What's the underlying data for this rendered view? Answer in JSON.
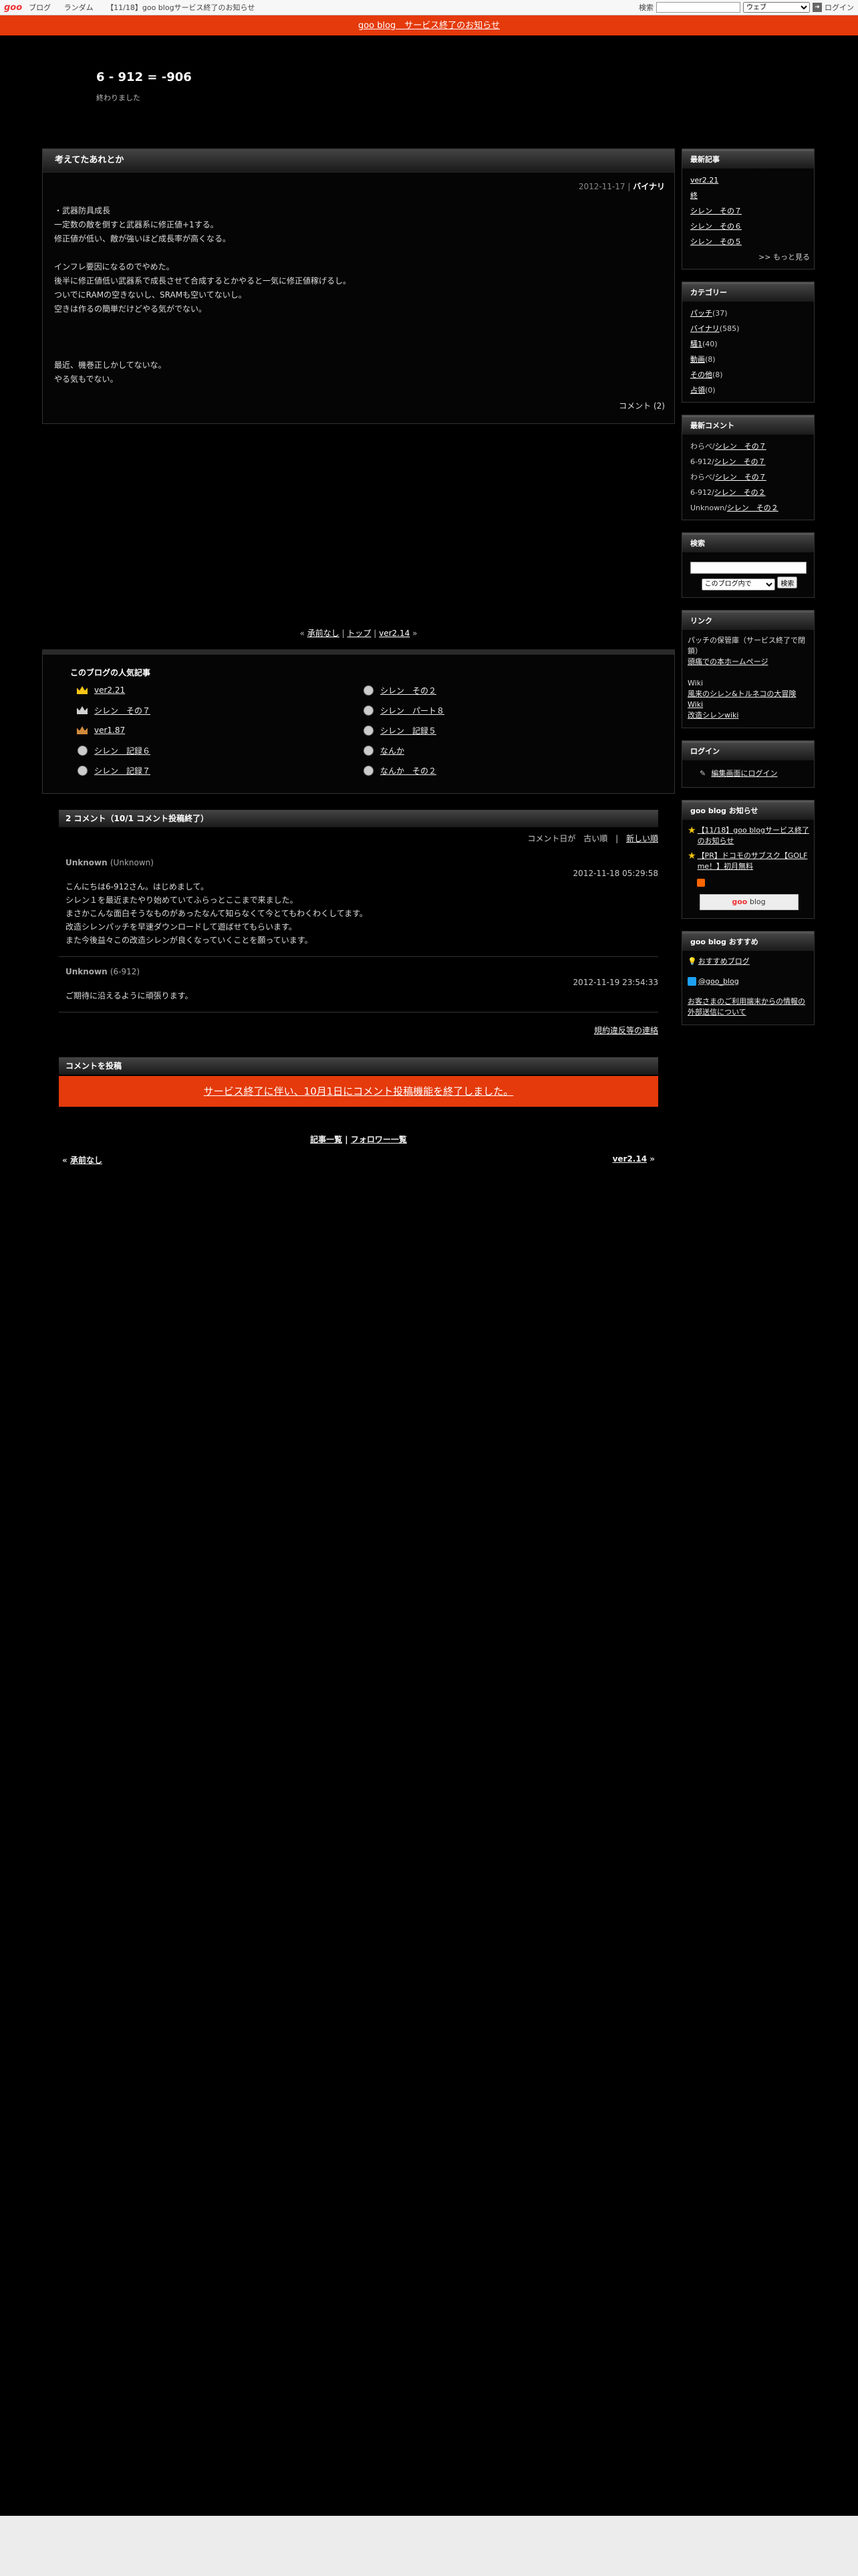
{
  "topbar": {
    "logo": "goo",
    "nav": [
      "ブログ",
      "ランダム",
      "【11/18】goo blogサービス終了のお知らせ"
    ],
    "search_label": "検索",
    "search_select": "ウェブ",
    "login": "ログイン"
  },
  "notice": "goo blog　サービス終了のお知らせ",
  "blog": {
    "title": "6 - 912 = -906",
    "description": "終わりました"
  },
  "entry": {
    "title": "考えてたあれとか",
    "date": "2012-11-17",
    "category": "バイナリ",
    "lines": [
      "・武器防具成長",
      "一定数の敵を倒すと武器系に修正値+1する。",
      "修正値が低い、敵が強いほど成長率が高くなる。",
      "",
      "インフレ要因になるのでやめた。",
      "後半に修正値低い武器系で成長させて合成するとかやると一気に修正値稼げるし。",
      "ついでにRAMの空きないし、SRAMも空いてないし。",
      "空きは作るの簡単だけどやる気がでない。",
      "",
      "",
      "",
      "最近、機巻正しかしてないな。",
      "やる気もでない。"
    ],
    "comment_link": "コメント (2)"
  },
  "pager": {
    "prev": "承前なし",
    "top": "トップ",
    "next": "ver2.14"
  },
  "popular": {
    "title": "このブログの人気記事",
    "items": [
      {
        "label": "ver2.21",
        "icon": "gold-crown-icon"
      },
      {
        "label": "シレン　その２",
        "icon": "gray-dot-icon"
      },
      {
        "label": "シレン　その７",
        "icon": "silver-crown-icon"
      },
      {
        "label": "シレン　パート８",
        "icon": "gray-dot-icon"
      },
      {
        "label": "ver1.87",
        "icon": "bronze-crown-icon"
      },
      {
        "label": "シレン　記録５",
        "icon": "gray-dot-icon"
      },
      {
        "label": "シレン　記録６",
        "icon": "gray-dot-icon"
      },
      {
        "label": "なんか",
        "icon": "gray-dot-icon"
      },
      {
        "label": "シレン　記録７",
        "icon": "gray-dot-icon"
      },
      {
        "label": "なんか　その２",
        "icon": "gray-dot-icon"
      }
    ]
  },
  "comments": {
    "header": "2 コメント（10/1 コメント投稿終了）",
    "sort_label": "コメント日が",
    "sort_old": "古い順",
    "sort_new": "新しい順",
    "items": [
      {
        "author": "Unknown",
        "author_id": "(Unknown)",
        "date": "2012-11-18 05:29:58",
        "lines": [
          "こんにちは6-912さん。はじめまして。",
          "シレン１を最近またやり始めていてふらっとここまで来ました。",
          "まさかこんな面白そうなものがあったなんて知らなくて今とてもわくわくしてます。",
          "改造シレンパッチを早速ダウンロードして遊ばせてもらいます。",
          "また今後益々この改造シレンが良くなっていくことを願っています。"
        ]
      },
      {
        "author": "Unknown",
        "author_id": "(6-912)",
        "date": "2012-11-19 23:54:33",
        "lines": [
          "ご期待に沿えるように頑張ります。"
        ]
      }
    ],
    "contrib_link": "規約違反等の連絡",
    "post_header": "コメントを投稿",
    "closed_notice": "サービス終了に伴い、10月1日にコメント投稿機能を終了しました。"
  },
  "footer_links": {
    "articles": "記事一覧",
    "followers": "フォロワー一覧"
  },
  "bottom_nav": {
    "prev": "承前なし",
    "next": "ver2.14"
  },
  "sidebar": {
    "recent": {
      "title": "最新記事",
      "items": [
        "ver2.21",
        "終",
        "シレン　その７",
        "シレン　その６",
        "シレン　その５"
      ],
      "more": ">> もっと見る"
    },
    "categories": {
      "title": "カテゴリー",
      "items": [
        {
          "name": "パッチ",
          "count": "(37)"
        },
        {
          "name": "バイナリ",
          "count": "(585)"
        },
        {
          "name": "騒1",
          "count": "(40)"
        },
        {
          "name": "動画",
          "count": "(8)"
        },
        {
          "name": "その他",
          "count": "(8)"
        },
        {
          "name": "占領",
          "count": "(0)"
        }
      ]
    },
    "recent_comments": {
      "title": "最新コメント",
      "items": [
        {
          "who": "わらべ/",
          "post": "シレン　その７"
        },
        {
          "who": "6-912/",
          "post": "シレン　その７"
        },
        {
          "who": "わらべ/",
          "post": "シレン　その７"
        },
        {
          "who": "6-912/",
          "post": "シレン　その２"
        },
        {
          "who": "Unknown/",
          "post": "シレン　その２"
        }
      ]
    },
    "search": {
      "title": "検索",
      "select": "このブログ内で",
      "button": "検索"
    },
    "links": {
      "title": "リンク",
      "intro": "パッチの保管庫（サービス終了で閉鎖）",
      "link1": "頭痛での本ホームページ",
      "wiki_label": "Wiki",
      "wiki1": "風来のシレン&トルネコの大冒険 Wiki",
      "wiki2": "改造シレンwiki"
    },
    "login": {
      "title": "ログイン",
      "edit": "編集画面にログイン"
    },
    "notices": {
      "title": "goo blog お知らせ",
      "items": [
        "【11/18】goo blogサービス終了のお知らせ",
        "【PR】ドコモのサブスク【GOLF me！】初月無料"
      ],
      "badge": "blog"
    },
    "recommend": {
      "title": "goo blog おすすめ",
      "blog": "おすすめブログ",
      "twitter": "@goo_blog",
      "info": "お客さまのご利用端末からの情報の外部送信について"
    }
  }
}
